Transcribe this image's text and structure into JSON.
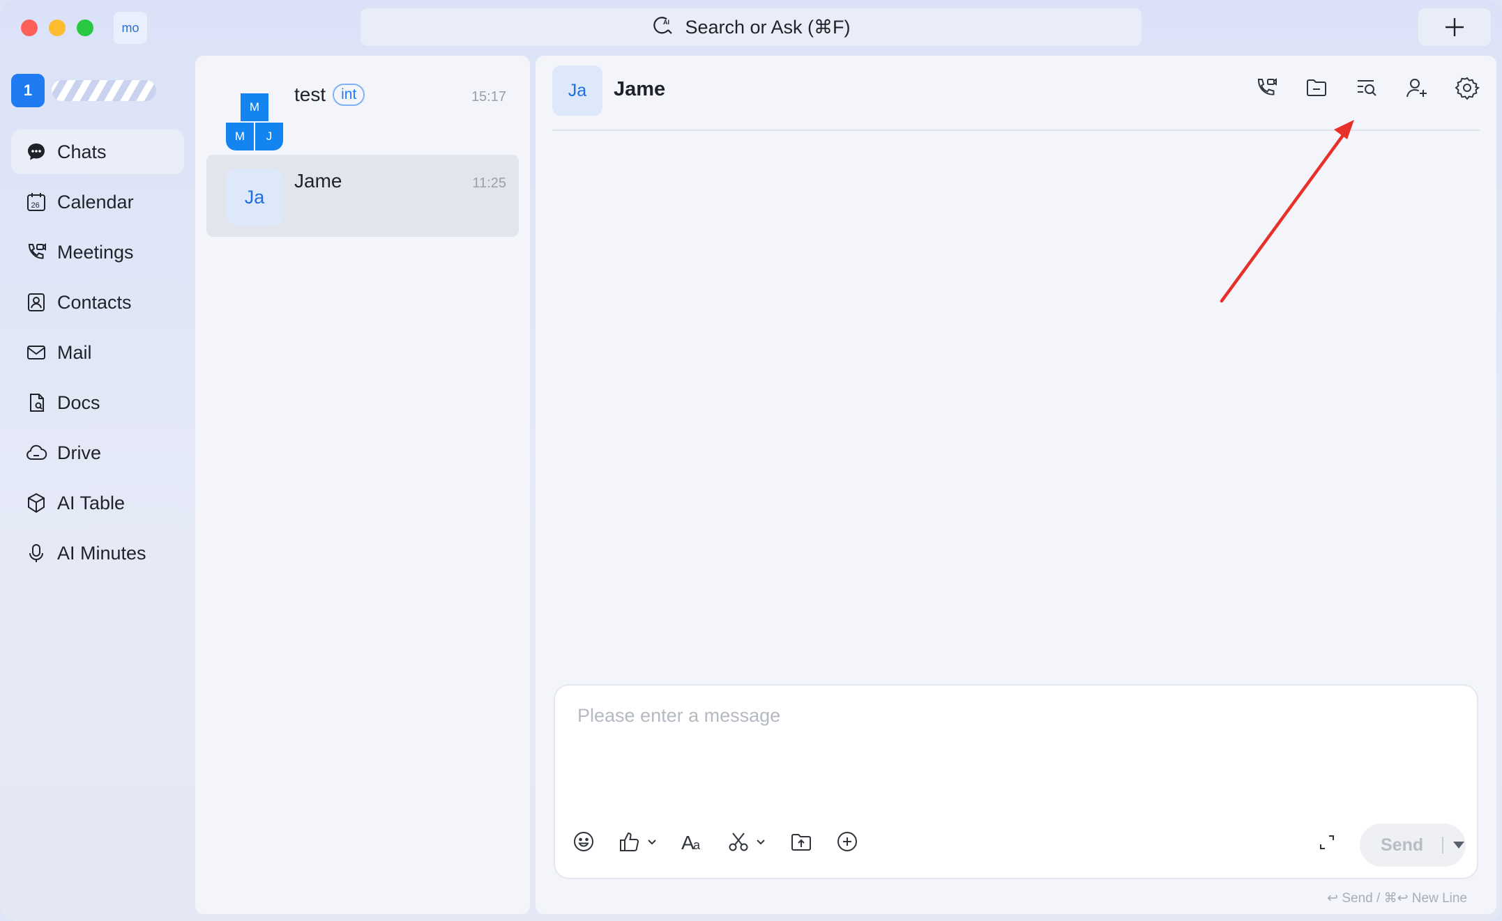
{
  "window": {
    "org_badge": "mo",
    "search_placeholder": "Search or Ask  (⌘F)",
    "search_icon": "ai-search-icon",
    "new_icon": "plus-icon"
  },
  "profile": {
    "badge": "1"
  },
  "sidebar": {
    "items": [
      {
        "label": "Chats",
        "icon": "chat-bubble-icon",
        "active": true
      },
      {
        "label": "Calendar",
        "icon": "calendar-icon"
      },
      {
        "label": "Meetings",
        "icon": "meetings-icon"
      },
      {
        "label": "Contacts",
        "icon": "contacts-icon"
      },
      {
        "label": "Mail",
        "icon": "mail-icon"
      },
      {
        "label": "Docs",
        "icon": "docs-icon"
      },
      {
        "label": "Drive",
        "icon": "cloud-drive-icon"
      },
      {
        "label": "AI Table",
        "icon": "ai-table-icon"
      },
      {
        "label": "AI Minutes",
        "icon": "ai-minutes-icon"
      }
    ]
  },
  "chat_list": [
    {
      "name": "test",
      "tag": "int",
      "time": "15:17",
      "avatar_cells": [
        "M",
        "M",
        "J"
      ]
    },
    {
      "name": "Jame",
      "time": "11:25",
      "avatar": "Ja",
      "selected": true
    }
  ],
  "conversation": {
    "avatar": "Ja",
    "name": "Jame",
    "header_icons": [
      "call-icon",
      "folder-icon",
      "search-history-icon",
      "add-member-icon",
      "settings-icon"
    ],
    "composer": {
      "placeholder": "Please enter a message",
      "tools": [
        "emoji-icon",
        "thumbs-up-icon",
        "text-format-icon",
        "screenshot-icon",
        "upload-file-icon",
        "more-plus-icon"
      ],
      "send_label": "Send",
      "hint": "↩ Send / ⌘↩ New Line"
    }
  },
  "annotation": {
    "arrow_color": "#e8302a"
  }
}
